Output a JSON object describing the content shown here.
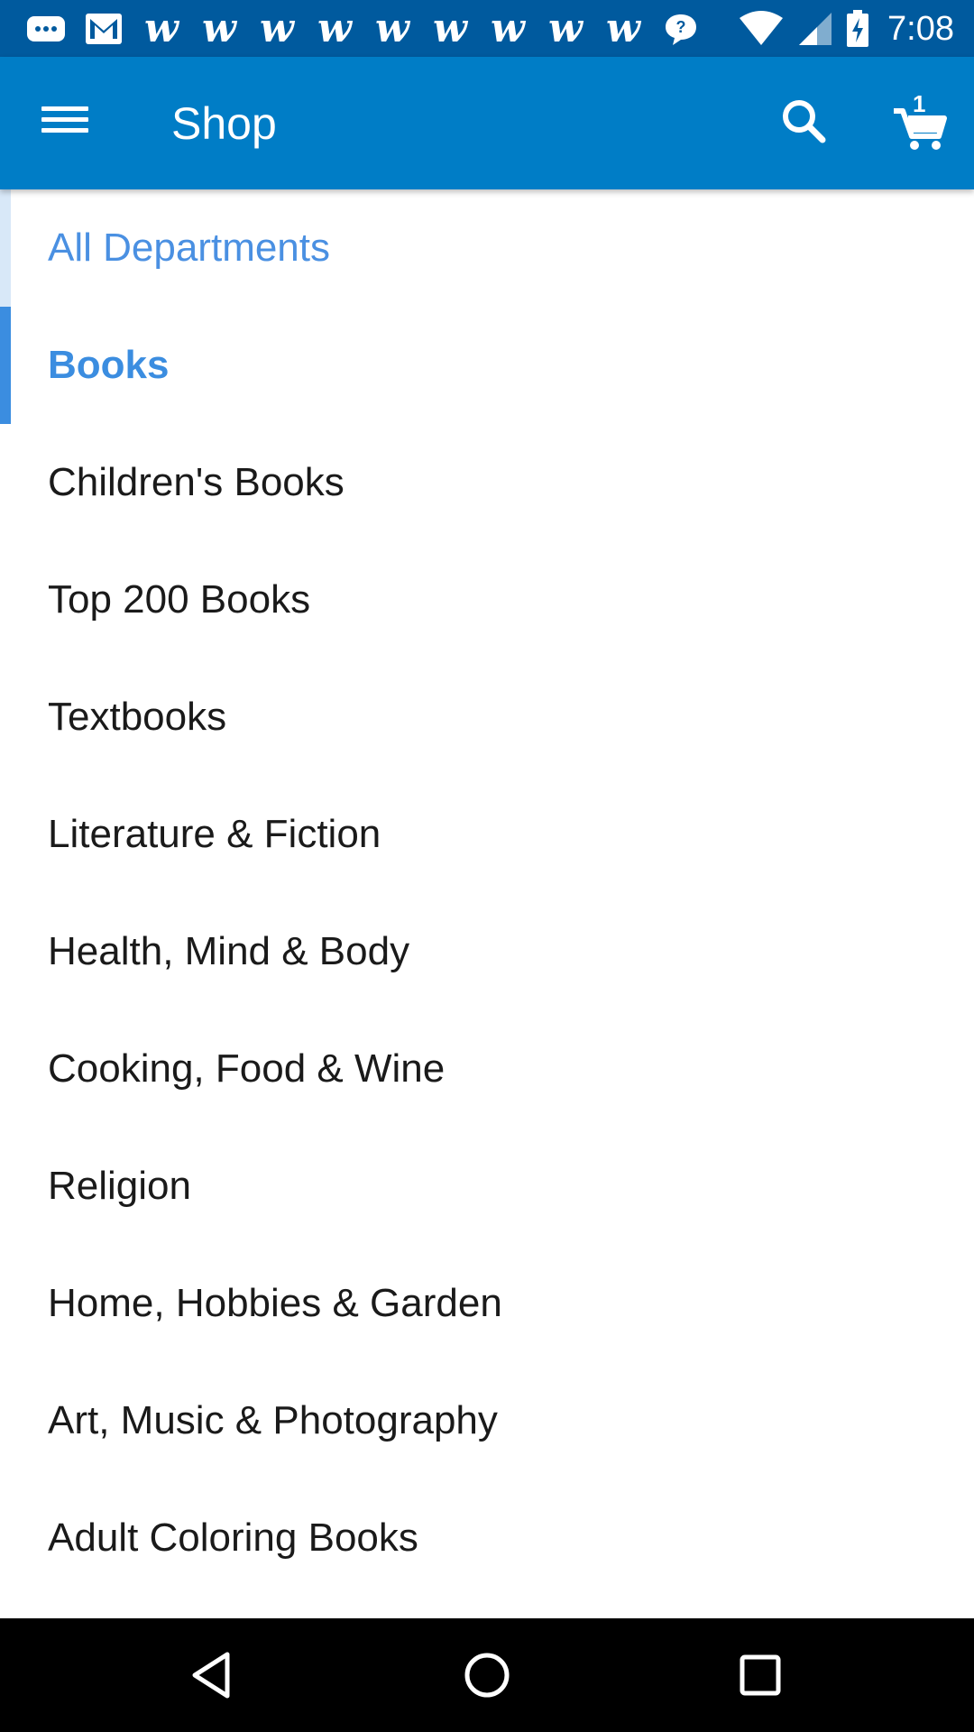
{
  "status_bar": {
    "time": "7:08",
    "notification_icons": [
      "message-icon",
      "gmail-icon",
      "walmart-icon",
      "walmart-icon",
      "walmart-icon",
      "walmart-icon",
      "walmart-icon",
      "walmart-icon",
      "walmart-icon",
      "walmart-icon",
      "walmart-icon",
      "chat-icon"
    ],
    "walmart_glyph": "w"
  },
  "app_bar": {
    "title": "Shop",
    "cart_count": "1",
    "background_color": "#007dc6"
  },
  "departments": {
    "parent_label": "All Departments",
    "current_label": "Books",
    "items": [
      "Children's Books",
      "Top 200 Books",
      "Textbooks",
      "Literature & Fiction",
      "Health, Mind & Body",
      "Cooking, Food & Wine",
      "Religion",
      "Home, Hobbies & Garden",
      "Art, Music & Photography",
      "Adult Coloring Books"
    ]
  },
  "colors": {
    "accent": "#3b8de0",
    "status_bar": "#005a9e"
  }
}
